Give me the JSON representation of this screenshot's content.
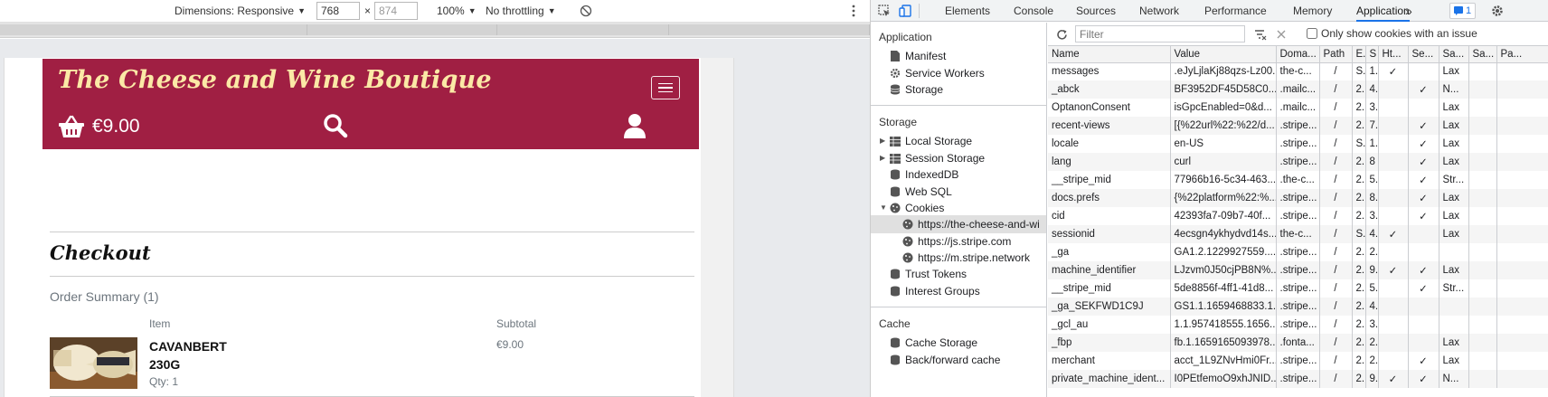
{
  "device_toolbar": {
    "dimensions_label": "Dimensions: Responsive",
    "width": "768",
    "times": "×",
    "height": "874",
    "zoom": "100%",
    "throttling": "No throttling"
  },
  "site": {
    "title": "The Cheese and Wine Boutique",
    "basket_total": "€9.00",
    "checkout_title": "Checkout",
    "order_summary": "Order Summary (1)",
    "col_item": "Item",
    "col_subtotal": "Subtotal",
    "product_name": "CAVANBERT 230G",
    "product_qty": "Qty: 1",
    "product_price": "€9.00",
    "brand_color": "#a01f43",
    "title_color": "#fbe9a6"
  },
  "devtools": {
    "tabs": [
      "Elements",
      "Console",
      "Sources",
      "Network",
      "Performance",
      "Memory",
      "Application"
    ],
    "active_tab": "Application",
    "more_tabs": "»",
    "issues_count": "1",
    "sidebar": {
      "application_header": "Application",
      "application_items": [
        "Manifest",
        "Service Workers",
        "Storage"
      ],
      "storage_header": "Storage",
      "storage_items": [
        "Local Storage",
        "Session Storage",
        "IndexedDB",
        "Web SQL",
        "Cookies"
      ],
      "cookie_origins": [
        "https://the-cheese-and-wi",
        "https://js.stripe.com",
        "https://m.stripe.network"
      ],
      "other_items": [
        "Trust Tokens",
        "Interest Groups"
      ],
      "cache_header": "Cache",
      "cache_items": [
        "Cache Storage",
        "Back/forward cache"
      ]
    },
    "cookies": {
      "filter_placeholder": "Filter",
      "only_issues_label": "Only show cookies with an issue",
      "columns": [
        "Name",
        "Value",
        "Doma...",
        "Path",
        "E.",
        "S",
        "Ht...",
        "Se...",
        "Sa...",
        "Sa...",
        "Pa..."
      ],
      "rows": [
        [
          "messages",
          ".eJyLjlaKj88qzs-Lz00...",
          "the-c...",
          "/",
          "S...",
          "1...",
          "✓",
          "",
          "Lax",
          "",
          ""
        ],
        [
          "_abck",
          "BF3952DF45D58C0...",
          ".mailc...",
          "/",
          "2...",
          "4...",
          "",
          "✓",
          "N...",
          "",
          ""
        ],
        [
          "OptanonConsent",
          "isGpcEnabled=0&d...",
          ".mailc...",
          "/",
          "2...",
          "3...",
          "",
          "",
          "Lax",
          "",
          ""
        ],
        [
          "recent-views",
          "[{%22url%22:%22/d...",
          ".stripe...",
          "/",
          "2...",
          "7...",
          "",
          "✓",
          "Lax",
          "",
          ""
        ],
        [
          "locale",
          "en-US",
          ".stripe...",
          "/",
          "S...",
          "1...",
          "",
          "✓",
          "Lax",
          "",
          ""
        ],
        [
          "lang",
          "curl",
          ".stripe...",
          "/",
          "2...",
          "8",
          "",
          "✓",
          "Lax",
          "",
          ""
        ],
        [
          "__stripe_mid",
          "77966b16-5c34-463...",
          ".the-c...",
          "/",
          "2...",
          "5...",
          "",
          "✓",
          "Str...",
          "",
          ""
        ],
        [
          "docs.prefs",
          "{%22platform%22:%...",
          ".stripe...",
          "/",
          "2...",
          "8...",
          "",
          "✓",
          "Lax",
          "",
          ""
        ],
        [
          "cid",
          "42393fa7-09b7-40f...",
          ".stripe...",
          "/",
          "2...",
          "3...",
          "",
          "✓",
          "Lax",
          "",
          ""
        ],
        [
          "sessionid",
          "4ecsgn4ykhydvd14s...",
          "the-c...",
          "/",
          "S...",
          "4...",
          "✓",
          "",
          "Lax",
          "",
          ""
        ],
        [
          "_ga",
          "GA1.2.1229927559....",
          ".stripe...",
          "/",
          "2...",
          "2...",
          "",
          "",
          "",
          "",
          ""
        ],
        [
          "machine_identifier",
          "LJzvm0J50cjPB8N%...",
          ".stripe...",
          "/",
          "2...",
          "9...",
          "✓",
          "✓",
          "Lax",
          "",
          ""
        ],
        [
          "__stripe_mid",
          "5de8856f-4ff1-41d8...",
          ".stripe...",
          "/",
          "2...",
          "5...",
          "",
          "✓",
          "Str...",
          "",
          ""
        ],
        [
          "_ga_SEKFWD1C9J",
          "GS1.1.1659468833.1...",
          ".stripe...",
          "/",
          "2...",
          "4...",
          "",
          "",
          "",
          "",
          ""
        ],
        [
          "_gcl_au",
          "1.1.957418555.1656...",
          ".stripe...",
          "/",
          "2...",
          "3...",
          "",
          "",
          "",
          "",
          ""
        ],
        [
          "_fbp",
          "fb.1.1659165093978...",
          ".fonta...",
          "/",
          "2...",
          "2...",
          "",
          "",
          "Lax",
          "",
          ""
        ],
        [
          "merchant",
          "acct_1L9ZNvHmi0Fr...",
          ".stripe...",
          "/",
          "2...",
          "2...",
          "",
          "✓",
          "Lax",
          "",
          ""
        ],
        [
          "private_machine_ident...",
          "I0PEtfemoO9xhJNID...",
          ".stripe...",
          "/",
          "2...",
          "9...",
          "✓",
          "✓",
          "N...",
          "",
          ""
        ]
      ]
    }
  }
}
